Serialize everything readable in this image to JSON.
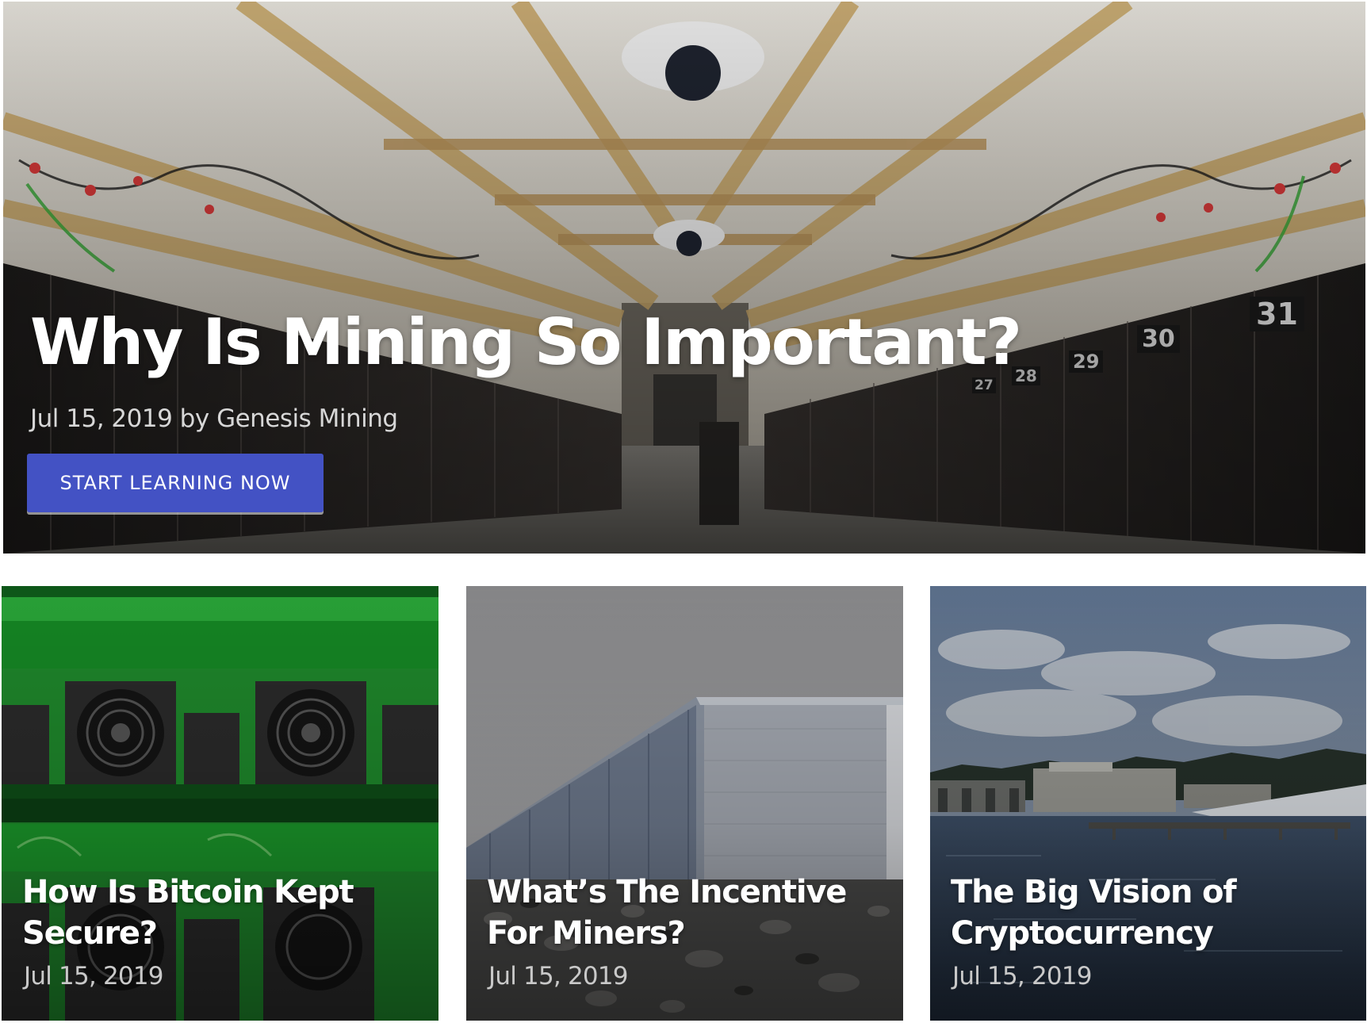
{
  "hero": {
    "title": "Why Is Mining So Important?",
    "date": "Jul 15, 2019",
    "by": "by",
    "author": "Genesis Mining",
    "cta_label": "START LEARNING NOW",
    "rack_numbers": [
      "31",
      "30",
      "29",
      "28",
      "27"
    ]
  },
  "cards": [
    {
      "title": "How Is Bitcoin Kept Secure?",
      "date": "Jul 15, 2019"
    },
    {
      "title": "What’s The Incentive For Miners?",
      "date": "Jul 15, 2019"
    },
    {
      "title": "The Big Vision of Cryptocurrency",
      "date": "Jul 15, 2019"
    }
  ],
  "colors": {
    "cta_background": "#4352c4",
    "title_text": "#ffffff",
    "meta_text": "#d7d7d7"
  }
}
